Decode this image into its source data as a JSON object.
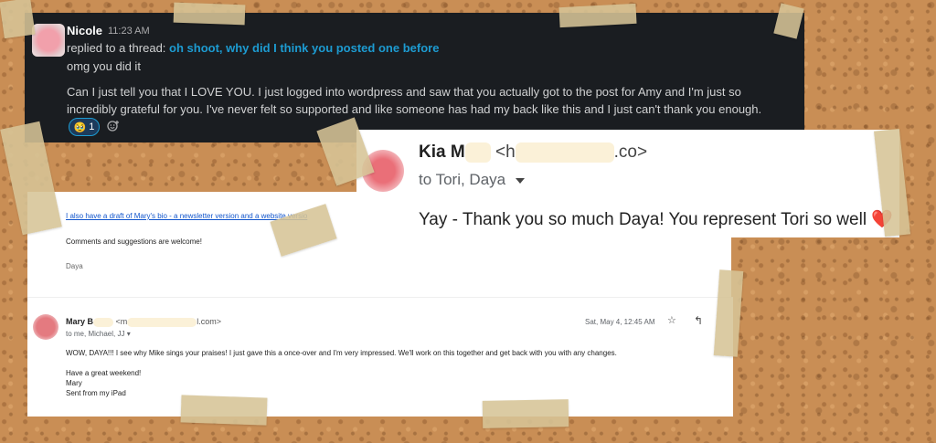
{
  "slack": {
    "sender": "Nicole",
    "time": "11:23 AM",
    "replied_prefix": "replied to a thread: ",
    "thread_link": "oh shoot, why did I think you posted one before",
    "line1": "omg you did it",
    "message": "Can I just tell you that I LOVE YOU. I just logged into wordpress and saw that you actually got to the post for Amy and I'm just so incredibly grateful for you. I've never felt so supported and like someone has had my back like this and I just can't thank you enough.",
    "reaction_emoji": "🥹",
    "reaction_count": "1",
    "add_reaction_icon": "add-emoji-icon"
  },
  "email_draft": {
    "link_text": "I also have a draft of Mary's bio - a newsletter version and a website versio",
    "comments": "Comments and suggestions are welcome!",
    "signature": "Daya"
  },
  "email_mary": {
    "sender_prefix": "Mary B",
    "email_prefix": "<m",
    "email_suffix": "l.com>",
    "to_line": "to me, Michael, JJ ▾",
    "date": "Sat, May 4, 12:45 AM",
    "star_icon": "star-icon",
    "reply_icon": "reply-icon",
    "body_line1": "WOW, DAYA!!!    I see why Mike sings your praises!  I just gave this a once-over and I'm very impressed.  We'll work on this together and get back with you with any changes.",
    "body_line2": "Have a great weekend!",
    "body_line3": "Mary",
    "body_line4": "Sent from my iPad"
  },
  "email_kia": {
    "sender_prefix": "Kia M",
    "email_prefix": "<h",
    "email_suffix": ".co>",
    "to_line": "to Tori, Daya",
    "message": "Yay - Thank you so much Daya! You represent Tori so well ❤️"
  },
  "colors": {
    "slack_bg": "#1a1d21",
    "slack_link": "#1d9bd1",
    "cork": "#c98e55",
    "tape": "#d6c496"
  }
}
